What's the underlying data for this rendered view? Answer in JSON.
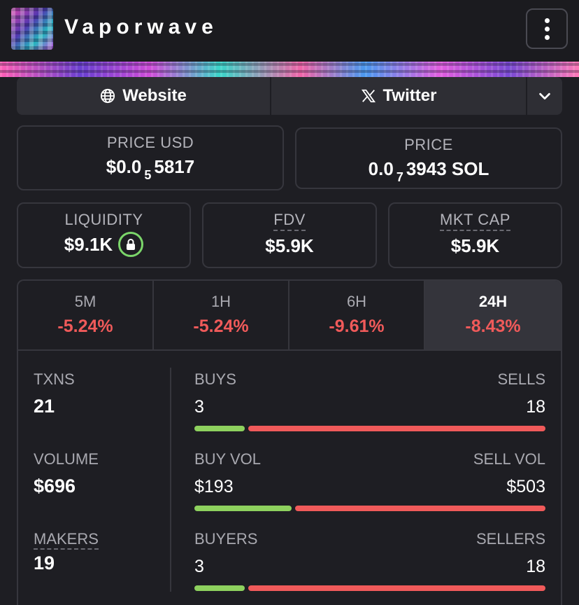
{
  "header": {
    "token_name": "Vaporwave",
    "menu_icon": "more-vertical-icon"
  },
  "links": {
    "website_label": "Website",
    "twitter_label": "Twitter"
  },
  "prices": {
    "price_usd_label": "PRICE USD",
    "price_usd_prefix": "$0.0",
    "price_usd_zeros": "5",
    "price_usd_digits": "5817",
    "price_label": "PRICE",
    "price_sol_prefix": "0.0",
    "price_sol_zeros": "7",
    "price_sol_digits": "3943 SOL"
  },
  "metrics": {
    "liquidity_label": "LIQUIDITY",
    "liquidity_value": "$9.1K",
    "fdv_label": "FDV",
    "fdv_value": "$5.9K",
    "mktcap_label": "MKT CAP",
    "mktcap_value": "$5.9K"
  },
  "timeframes": [
    {
      "label": "5M",
      "change": "-5.24%"
    },
    {
      "label": "1H",
      "change": "-5.24%"
    },
    {
      "label": "6H",
      "change": "-9.61%"
    },
    {
      "label": "24H",
      "change": "-8.43%",
      "active": true
    }
  ],
  "stats": {
    "txns_label": "TXNS",
    "txns_value": "21",
    "volume_label": "VOLUME",
    "volume_value": "$696",
    "makers_label": "MAKERS",
    "makers_value": "19",
    "buys_label": "BUYS",
    "sells_label": "SELLS",
    "buys_value": "3",
    "sells_value": "18",
    "buys_fraction": 0.143,
    "buy_vol_label": "BUY VOL",
    "sell_vol_label": "SELL VOL",
    "buy_vol_value": "$193",
    "sell_vol_value": "$503",
    "buy_vol_fraction": 0.277,
    "buyers_label": "BUYERS",
    "sellers_label": "SELLERS",
    "buyers_value": "3",
    "sellers_value": "18",
    "buyers_fraction": 0.143
  },
  "colors": {
    "positive": "#8ed15e",
    "negative": "#f05a5a",
    "background": "#1e1e23"
  }
}
